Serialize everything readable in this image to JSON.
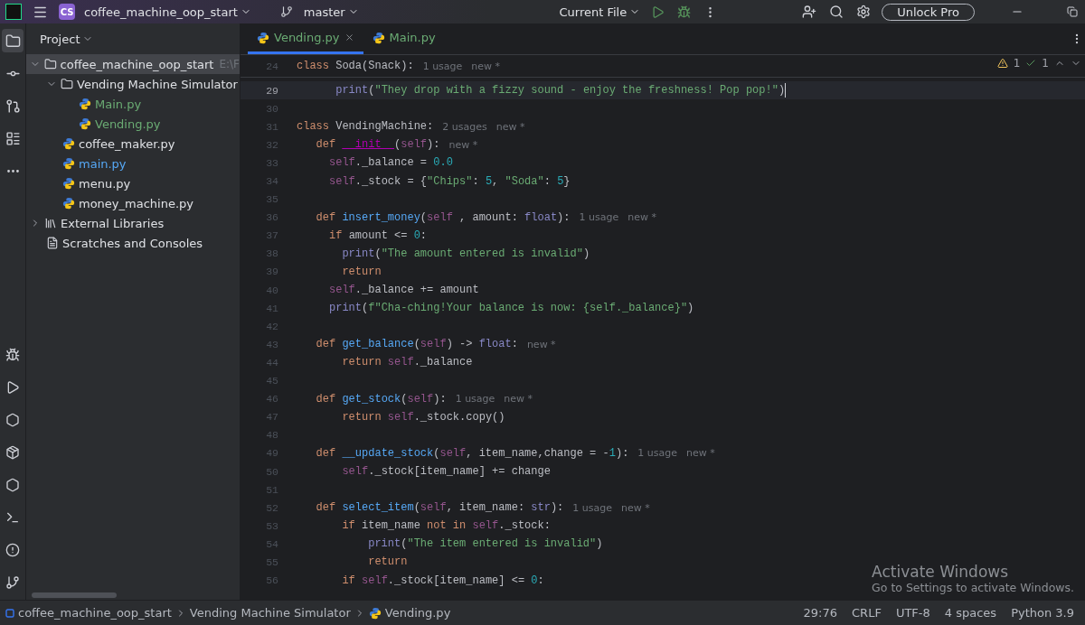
{
  "title_bar": {
    "project_badge": "CS",
    "project": "coffee_machine_oop_start",
    "branch": "master",
    "run_config": "Current File",
    "unlock": "Unlock Pro"
  },
  "stripe": {
    "top": [
      {
        "selected": true
      },
      {
        "selected": false
      },
      {
        "selected": false
      },
      {
        "selected": false
      },
      {
        "selected": false
      }
    ],
    "bottom": [
      {
        "selected": false
      },
      {
        "selected": false
      },
      {
        "selected": false
      },
      {
        "selected": false
      },
      {
        "selected": false
      },
      {
        "selected": false
      },
      {
        "selected": false
      },
      {
        "selected": false
      }
    ]
  },
  "project_panel": {
    "title": "Project",
    "tree": [
      {
        "name": "coffee_machine_oop_start",
        "kind": "folder",
        "path": "E:\\F",
        "expanded": true,
        "selected": true,
        "color": "#dfe1e5",
        "children": [
          {
            "name": "Vending Machine Simulator",
            "kind": "folder",
            "expanded": true,
            "selected": false,
            "color": "#dfe1e5",
            "children": [
              {
                "name": "Main.py",
                "kind": "py",
                "selected": false,
                "color": "#6aab73"
              },
              {
                "name": "Vending.py",
                "kind": "py",
                "selected": false,
                "color": "#6aab73"
              }
            ]
          },
          {
            "name": "coffee_maker.py",
            "kind": "py",
            "selected": false,
            "color": "#dfe1e5"
          },
          {
            "name": "main.py",
            "kind": "py",
            "selected": false,
            "color": "#56a8f5"
          },
          {
            "name": "menu.py",
            "kind": "py",
            "selected": false,
            "color": "#dfe1e5"
          },
          {
            "name": "money_machine.py",
            "kind": "py",
            "selected": false,
            "color": "#dfe1e5"
          }
        ]
      },
      {
        "name": "External Libraries",
        "kind": "lib",
        "expanded": false,
        "selected": false,
        "color": "#dfe1e5"
      },
      {
        "name": "Scratches and Consoles",
        "kind": "scratch",
        "selected": false,
        "color": "#dfe1e5"
      }
    ]
  },
  "editor": {
    "tabs": [
      {
        "label": "Vending.py",
        "selected": true,
        "color": "#6aab73"
      },
      {
        "label": "Main.py",
        "selected": false,
        "color": "#6aab73"
      }
    ],
    "inspections": {
      "warnings": "1",
      "typos": "1"
    },
    "sticky_line": {
      "n": "24",
      "code": "class Soda(Snack):",
      "hints": [
        "1 usage",
        "new *"
      ]
    },
    "lines": [
      {
        "n": "29",
        "current": true,
        "code": "      print(\"They drop with a fizzy sound - enjoy the freshness! Pop pop!\")"
      },
      {
        "n": "30",
        "current": false
      },
      {
        "n": "31",
        "current": false,
        "code": "class VendingMachine:",
        "hints": [
          "2 usages",
          "new *"
        ]
      },
      {
        "n": "32",
        "current": false,
        "code": "   def __init__(self):",
        "hints": [
          "new *"
        ]
      },
      {
        "n": "33",
        "current": false,
        "code": "     self._balance = 0.0"
      },
      {
        "n": "34",
        "current": false,
        "code": "     self._stock = {\"Chips\": 5, \"Soda\": 5}"
      },
      {
        "n": "35",
        "current": false
      },
      {
        "n": "36",
        "current": false,
        "code": "   def insert_money(self , amount: float):",
        "hints": [
          "1 usage",
          "new *"
        ]
      },
      {
        "n": "37",
        "current": false,
        "code": "     if amount <= 0:"
      },
      {
        "n": "38",
        "current": false,
        "code": "       print(\"The amount entered is invalid\")"
      },
      {
        "n": "39",
        "current": false,
        "code": "       return"
      },
      {
        "n": "40",
        "current": false,
        "code": "     self._balance += amount"
      },
      {
        "n": "41",
        "current": false,
        "code": "     print(f\"Cha-ching!Your balance is now: {self._balance}\")"
      },
      {
        "n": "42",
        "current": false
      },
      {
        "n": "43",
        "current": false,
        "code": "   def get_balance(self) -> float:",
        "hints": [
          "new *"
        ]
      },
      {
        "n": "44",
        "current": false,
        "code": "       return self._balance"
      },
      {
        "n": "45",
        "current": false
      },
      {
        "n": "46",
        "current": false,
        "code": "   def get_stock(self):",
        "hints": [
          "1 usage",
          "new *"
        ]
      },
      {
        "n": "47",
        "current": false,
        "code": "       return self._stock.copy()"
      },
      {
        "n": "48",
        "current": false
      },
      {
        "n": "49",
        "current": false,
        "code": "   def __update_stock(self, item_name,change = -1):",
        "hints": [
          "1 usage",
          "new *"
        ]
      },
      {
        "n": "50",
        "current": false,
        "code": "       self._stock[item_name] += change"
      },
      {
        "n": "51",
        "current": false
      },
      {
        "n": "52",
        "current": false,
        "code": "   def select_item(self, item_name: str):",
        "hints": [
          "1 usage",
          "new *"
        ]
      },
      {
        "n": "53",
        "current": false,
        "code": "       if item_name not in self._stock:"
      },
      {
        "n": "54",
        "current": false,
        "code": "           print(\"The item entered is invalid\")"
      },
      {
        "n": "55",
        "current": false,
        "code": "           return"
      },
      {
        "n": "56",
        "current": false,
        "code": "       if self._stock[item_name] <= 0:"
      }
    ]
  },
  "os_overlay": {
    "title": "Activate Windows",
    "subtitle": "Go to Settings to activate Windows."
  },
  "status_bar": {
    "breadcrumbs": [
      {
        "label": "coffee_machine_oop_start",
        "kind": "module"
      },
      {
        "label": "Vending Machine Simulator",
        "kind": "folder"
      },
      {
        "label": "Vending.py",
        "kind": "py"
      }
    ],
    "items": [
      "29:76",
      "CRLF",
      "UTF-8",
      "4 spaces",
      "Python 3.9"
    ]
  }
}
